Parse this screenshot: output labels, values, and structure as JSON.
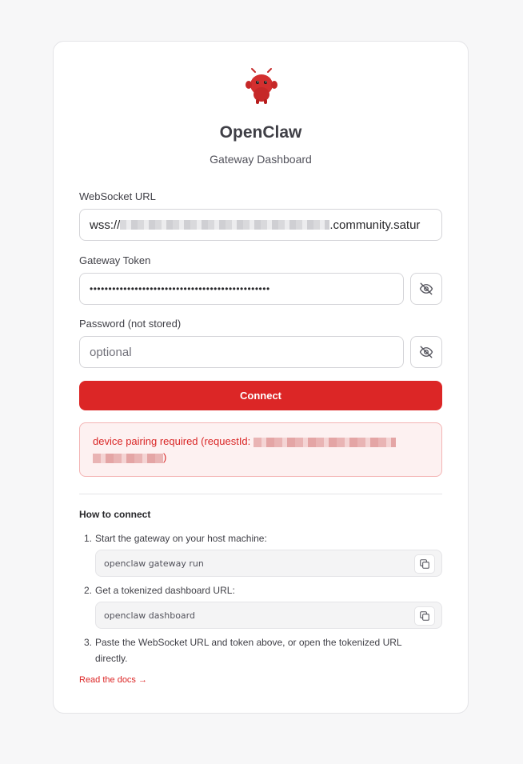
{
  "header": {
    "title": "OpenClaw",
    "subtitle": "Gateway Dashboard"
  },
  "form": {
    "websocket_label": "WebSocket URL",
    "websocket_value_prefix": "wss://",
    "websocket_value_suffix": ".community.satur",
    "token_label": "Gateway Token",
    "token_value": "••••••••••••••••••••••••••••••••••••••••••••••••",
    "password_label": "Password (not stored)",
    "password_placeholder": "optional",
    "connect_label": "Connect"
  },
  "error": {
    "prefix": "device pairing required (requestId: ",
    "suffix": ")"
  },
  "howto": {
    "title": "How to connect",
    "steps": [
      {
        "num": "1.",
        "text": "Start the gateway on your host machine:",
        "code": "openclaw gateway run"
      },
      {
        "num": "2.",
        "text": "Get a tokenized dashboard URL:",
        "code": "openclaw dashboard"
      },
      {
        "num": "3.",
        "text": "Paste the WebSocket URL and token above, or open the tokenized URL directly."
      }
    ],
    "docs_link": "Read the docs →"
  },
  "colors": {
    "accent": "#dc2626",
    "error_bg": "#fdf1f1",
    "error_border": "#f3b4b4",
    "page_bg": "#f7f7f8"
  },
  "icons": {
    "logo": "lobster-mascot-icon",
    "toggle_visibility": "eye-off-icon",
    "copy": "copy-icon"
  }
}
